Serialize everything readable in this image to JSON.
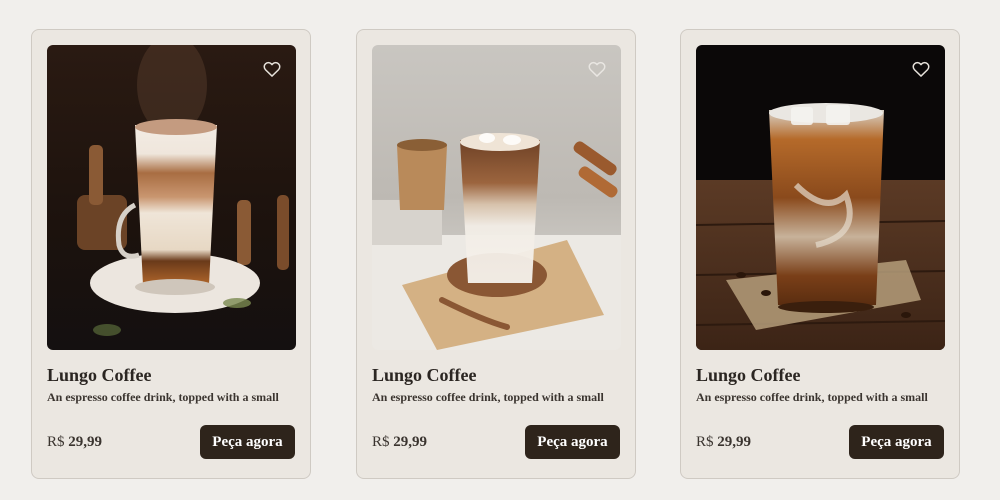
{
  "products": [
    {
      "title": "Lungo Coffee",
      "description": "An espresso coffee drink, topped with a small",
      "currency": "R$",
      "price": "29,99",
      "button_label": "Peça agora",
      "favorite_icon": "heart-outline-icon",
      "image": "layered latte macchiato in glass mug with cocoa powder, dark background"
    },
    {
      "title": "Lungo Coffee",
      "description": "An espresso coffee drink, topped with a small",
      "currency": "R$",
      "price": "29,99",
      "button_label": "Peça agora",
      "favorite_icon": "heart-outline-icon",
      "image": "iced coffee with milk on wooden board, light background"
    },
    {
      "title": "Lungo Coffee",
      "description": "An espresso coffee drink, topped with a small",
      "currency": "R$",
      "price": "29,99",
      "button_label": "Peça agora",
      "favorite_icon": "heart-outline-icon",
      "image": "iced coffee with cream swirl on rustic wooden table"
    }
  ],
  "colors": {
    "background": "#f1efec",
    "card": "#ebe7e1",
    "button": "#2e241b",
    "text": "#2b2622"
  }
}
